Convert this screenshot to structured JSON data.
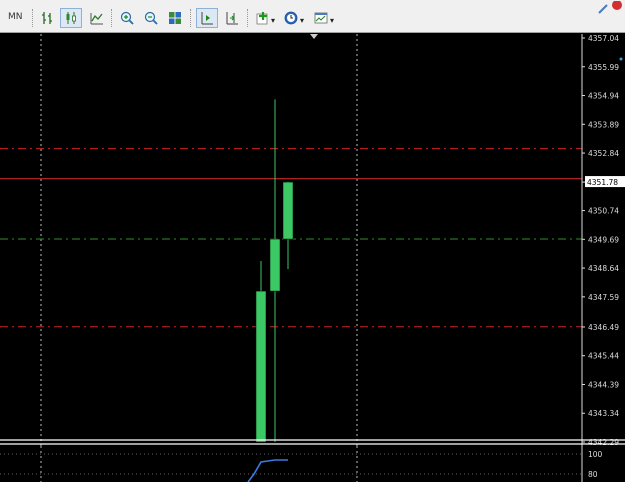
{
  "toolbar": {
    "timeframe_label": "MN",
    "buttons": [
      {
        "icon": "bar-chart-icon"
      },
      {
        "icon": "candlestick-chart-icon"
      },
      {
        "icon": "line-chart-icon"
      },
      {
        "icon": "zoom-in-icon"
      },
      {
        "icon": "zoom-out-icon"
      },
      {
        "icon": "tile-windows-icon"
      },
      {
        "icon": "autoscroll-icon"
      },
      {
        "icon": "chart-shift-icon"
      },
      {
        "icon": "indicators-icon"
      },
      {
        "icon": "periods-clock-icon"
      },
      {
        "icon": "templates-icon"
      }
    ]
  },
  "chart_data": {
    "type": "candlestick",
    "price_axis": [
      "4357.04",
      "4355.99",
      "4354.94",
      "4353.89",
      "4352.84",
      "4351.78",
      "4350.74",
      "4349.69",
      "4348.64",
      "4347.59",
      "4346.49",
      "4345.44",
      "4344.39",
      "4343.34",
      "4342.29"
    ],
    "current_price": "4351.78",
    "candles": [
      {
        "open": 4342.29,
        "high": 4348.9,
        "low": 4342.29,
        "close": 4347.8
      },
      {
        "open": 4347.8,
        "high": 4354.8,
        "low": 4342.29,
        "close": 4349.7
      },
      {
        "open": 4349.7,
        "high": 4351.8,
        "low": 4348.6,
        "close": 4351.78
      }
    ],
    "level_lines": [
      {
        "price": 4353.0,
        "color": "#cc2222",
        "style": "dash-dot"
      },
      {
        "price": 4351.9,
        "color": "#e03030",
        "style": "solid"
      },
      {
        "price": 4349.7,
        "color": "#2e8b2e",
        "style": "dash-dot"
      },
      {
        "price": 4346.5,
        "color": "#cc2222",
        "style": "dash-dot"
      }
    ],
    "indicator_axis": [
      "100",
      "80"
    ],
    "indicator_line_color": "#3a7be0",
    "candle_color": "#3cc864",
    "grid": true
  }
}
